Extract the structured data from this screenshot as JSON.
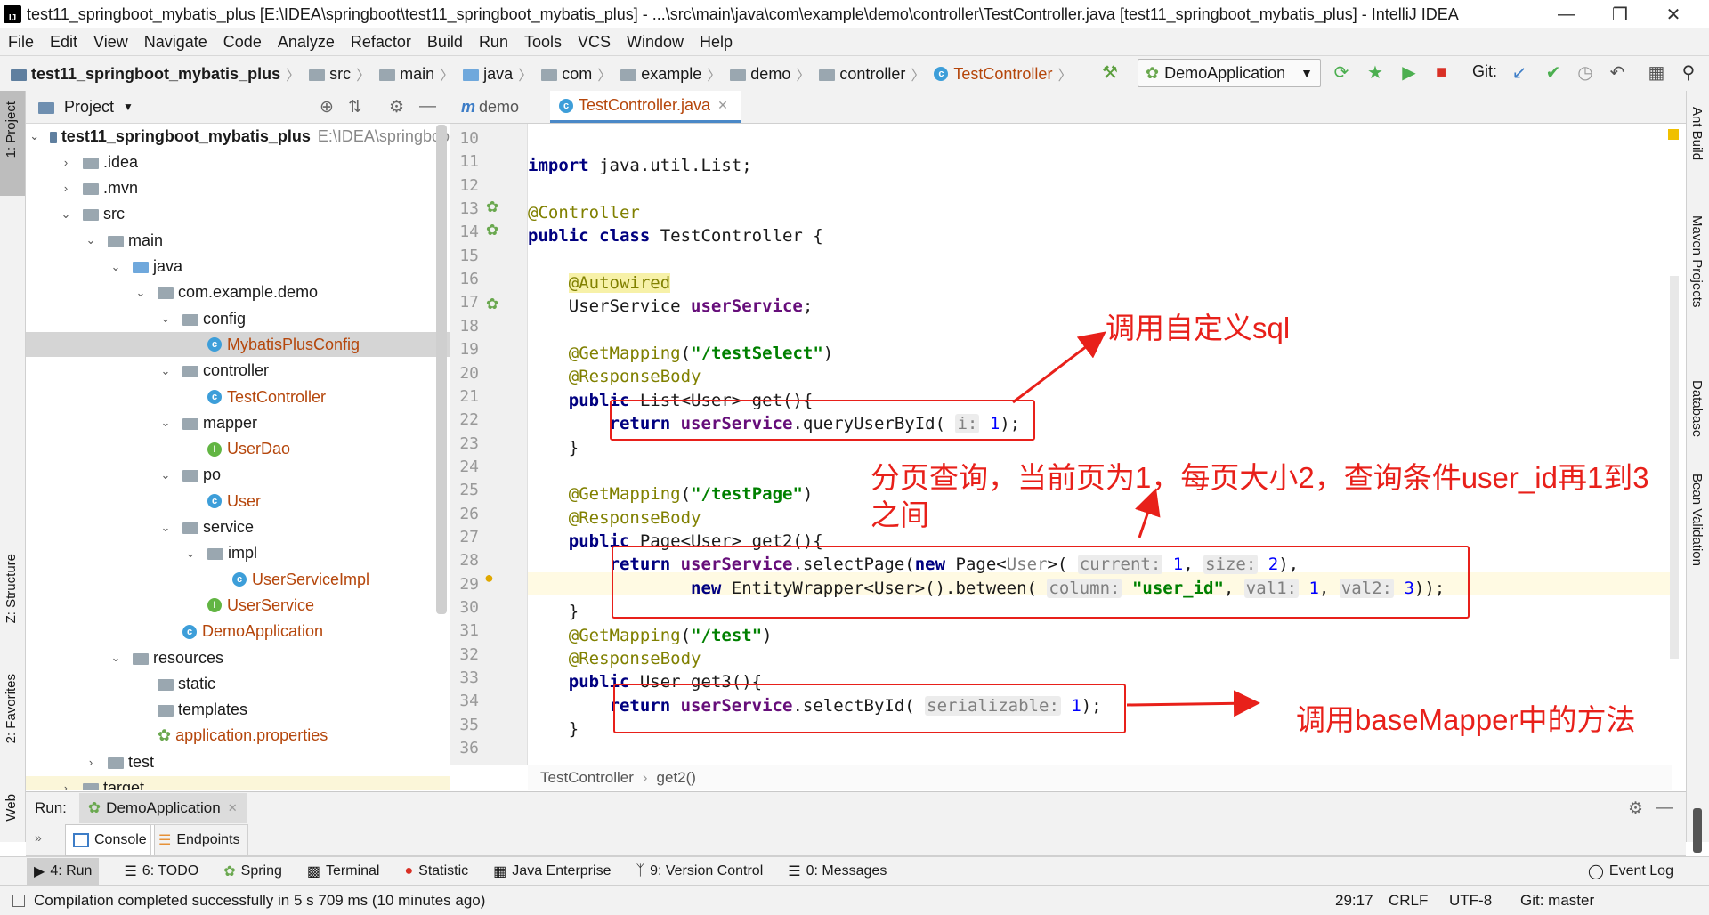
{
  "window": {
    "title": "test11_springboot_mybatis_plus [E:\\IDEA\\springboot\\test11_springboot_mybatis_plus] - ...\\src\\main\\java\\com\\example\\demo\\controller\\TestController.java [test11_springboot_mybatis_plus] - IntelliJ IDEA",
    "app_icon_text": "IJ"
  },
  "menu": [
    "File",
    "Edit",
    "View",
    "Navigate",
    "Code",
    "Analyze",
    "Refactor",
    "Build",
    "Run",
    "Tools",
    "VCS",
    "Window",
    "Help"
  ],
  "breadcrumb": [
    "test11_springboot_mybatis_plus",
    "src",
    "main",
    "java",
    "com",
    "example",
    "demo",
    "controller",
    "TestController"
  ],
  "toolbar": {
    "run_config": "DemoApplication",
    "git_label": "Git:"
  },
  "left_strip": {
    "project": "1: Project",
    "structure": "Z: Structure",
    "favorites": "2: Favorites",
    "web": "Web"
  },
  "right_strip": {
    "ant": "Ant Build",
    "maven": "Maven Projects",
    "database": "Database",
    "bean": "Bean Validation"
  },
  "project_panel": {
    "title": "Project",
    "tree": [
      {
        "label": "test11_springboot_mybatis_plus",
        "extra": "E:\\IDEA\\springboo",
        "icon": "module",
        "indent": 0,
        "arrow": "▾",
        "bold": true
      },
      {
        "label": ".idea",
        "icon": "folder",
        "indent": 1,
        "arrow": "▸"
      },
      {
        "label": ".mvn",
        "icon": "folder",
        "indent": 1,
        "arrow": "▸"
      },
      {
        "label": "src",
        "icon": "folder",
        "indent": 1,
        "arrow": "▾"
      },
      {
        "label": "main",
        "icon": "folder",
        "indent": 2,
        "arrow": "▾"
      },
      {
        "label": "java",
        "icon": "folder-blue",
        "indent": 3,
        "arrow": "▾"
      },
      {
        "label": "com.example.demo",
        "icon": "package",
        "indent": 4,
        "arrow": "▾"
      },
      {
        "label": "config",
        "icon": "package",
        "indent": 5,
        "arrow": "▾"
      },
      {
        "label": "MybatisPlusConfig",
        "icon": "class",
        "indent": 6,
        "arrow": "",
        "orange": true,
        "selected": true
      },
      {
        "label": "controller",
        "icon": "package",
        "indent": 5,
        "arrow": "▾"
      },
      {
        "label": "TestController",
        "icon": "class",
        "indent": 6,
        "arrow": "",
        "orange": true
      },
      {
        "label": "mapper",
        "icon": "package",
        "indent": 5,
        "arrow": "▾"
      },
      {
        "label": "UserDao",
        "icon": "interface",
        "indent": 6,
        "arrow": "",
        "orange": true
      },
      {
        "label": "po",
        "icon": "package",
        "indent": 5,
        "arrow": "▾"
      },
      {
        "label": "User",
        "icon": "class",
        "indent": 6,
        "arrow": "",
        "orange": true
      },
      {
        "label": "service",
        "icon": "package",
        "indent": 5,
        "arrow": "▾"
      },
      {
        "label": "impl",
        "icon": "package",
        "indent": 6,
        "arrow": "▾"
      },
      {
        "label": "UserServiceImpl",
        "icon": "class",
        "indent": 7,
        "arrow": "",
        "orange": true
      },
      {
        "label": "UserService",
        "icon": "interface",
        "indent": 6,
        "arrow": "",
        "orange": true
      },
      {
        "label": "DemoApplication",
        "icon": "spring-class",
        "indent": 5,
        "arrow": "",
        "orange": true
      },
      {
        "label": "resources",
        "icon": "folder-res",
        "indent": 3,
        "arrow": "▾"
      },
      {
        "label": "static",
        "icon": "folder",
        "indent": 4,
        "arrow": ""
      },
      {
        "label": "templates",
        "icon": "folder",
        "indent": 4,
        "arrow": ""
      },
      {
        "label": "application.properties",
        "icon": "spring-props",
        "indent": 4,
        "arrow": "",
        "orange": true
      },
      {
        "label": "test",
        "icon": "folder",
        "indent": 2,
        "arrow": "▸"
      },
      {
        "label": "target",
        "icon": "folder",
        "indent": 1,
        "arrow": "▸"
      }
    ]
  },
  "editor": {
    "tabs": [
      "demo",
      "TestController.java"
    ],
    "line_numbers": [
      "10",
      "11",
      "12",
      "13",
      "14",
      "15",
      "16",
      "17",
      "18",
      "19",
      "20",
      "21",
      "22",
      "23",
      "24",
      "25",
      "26",
      "27",
      "28",
      "29",
      "30",
      "31",
      "32",
      "33",
      "34",
      "35",
      "36"
    ],
    "breadcrumb": [
      "TestController",
      "get2()"
    ]
  },
  "annotations": {
    "a1": "调用自定义sql",
    "a2_line1": "分页查询，当前页为1，每页大小2，查询条件user_id再1到3",
    "a2_line2": "之间",
    "a3": "调用baseMapper中的方法"
  },
  "run_panel": {
    "label": "Run:",
    "config": "DemoApplication",
    "tabs": [
      "Console",
      "Endpoints"
    ]
  },
  "bottom_tools": [
    "4: Run",
    "6: TODO",
    "Spring",
    "Terminal",
    "Statistic",
    "Java Enterprise",
    "9: Version Control",
    "0: Messages"
  ],
  "event_log": "Event Log",
  "status": {
    "message": "Compilation completed successfully in 5 s 709 ms (10 minutes ago)",
    "position": "29:17",
    "line_sep": "CRLF",
    "encoding": "UTF-8",
    "git": "Git: master"
  }
}
